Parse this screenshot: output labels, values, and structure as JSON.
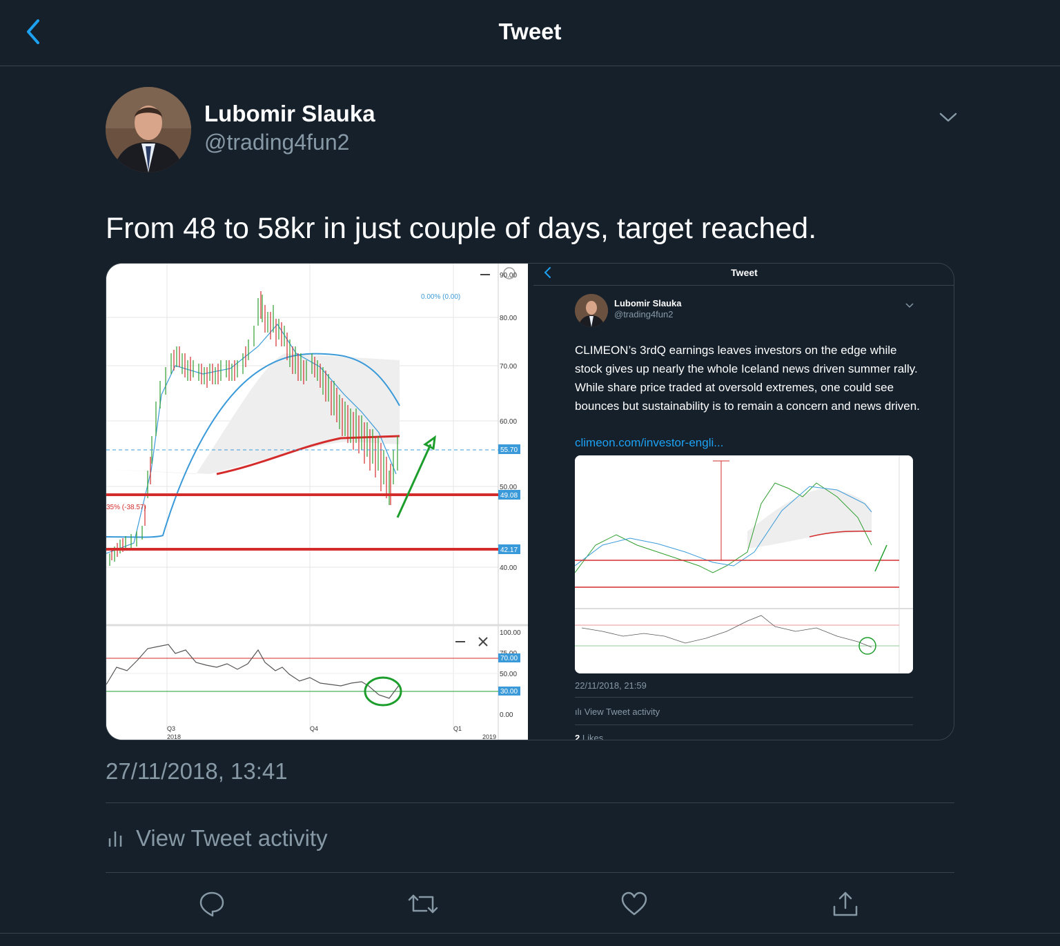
{
  "header": {
    "title": "Tweet",
    "back_icon": "chevron-left-icon"
  },
  "author": {
    "name": "Lubomir Slauka",
    "handle": "@trading4fun2"
  },
  "tweet": {
    "text": "From 48 to 58kr in just couple of days, target reached.",
    "date": "27/11/2018, 13:41",
    "activity_label": "View Tweet activity"
  },
  "colors": {
    "accent": "#1da1f2",
    "background": "#15202b",
    "muted": "#8899a6",
    "divider": "#38444d"
  },
  "chart_left": {
    "top_label": "0.00% (0.00)",
    "y_ticks": [
      "90.00",
      "80.00",
      "70.00",
      "60.00",
      "50.00",
      "40.00"
    ],
    "price_tags": [
      "55.70",
      "49.08",
      "42.17"
    ],
    "annotation": "35% (-38.57)",
    "rsi_ticks": [
      "100.00",
      "75.00",
      "50.00",
      "0.00"
    ],
    "rsi_tags": [
      "70.00",
      "30.00"
    ],
    "x_ticks": [
      "Q3",
      "Q4",
      "Q1"
    ],
    "x_years": [
      "2018",
      "2019"
    ]
  },
  "nested": {
    "header_title": "Tweet",
    "author_name": "Lubomir Slauka",
    "author_handle": "@trading4fun2",
    "text": "CLIMEON’s 3rdQ earnings leaves investors on the edge while stock gives up nearly the whole Iceland news driven summer rally. While share price traded at oversold extremes, one could see bounces but sustainability is to remain a concern and news driven.",
    "link": "climeon.com/investor-engli...",
    "date": "22/11/2018, 21:59",
    "activity_label": "View Tweet activity",
    "likes_count": "2",
    "likes_label": "Likes"
  }
}
